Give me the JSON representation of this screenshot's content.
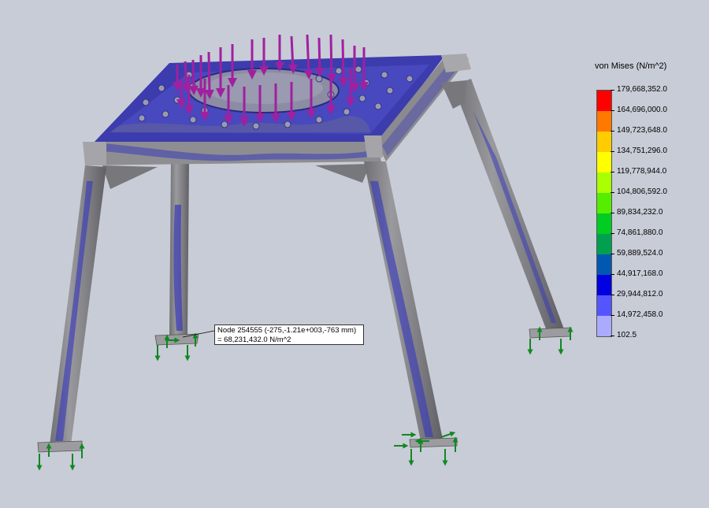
{
  "legend": {
    "title": "von Mises (N/m^2)",
    "levels": [
      {
        "value": "179,668,352.0",
        "color": "#ff0000"
      },
      {
        "value": "164,696,000.0",
        "color": "#ff7800"
      },
      {
        "value": "149,723,648.0",
        "color": "#ffcc00"
      },
      {
        "value": "134,751,296.0",
        "color": "#ffff00"
      },
      {
        "value": "119,778,944.0",
        "color": "#aaff00"
      },
      {
        "value": "104,806,592.0",
        "color": "#55ee00"
      },
      {
        "value": "89,834,232.0",
        "color": "#00cc22"
      },
      {
        "value": "74,861,880.0",
        "color": "#00a050"
      },
      {
        "value": "59,889,524.0",
        "color": "#0058b0"
      },
      {
        "value": "44,917,168.0",
        "color": "#0000e0"
      },
      {
        "value": "29,944,812.0",
        "color": "#5555ff"
      },
      {
        "value": "14,972,458.0",
        "color": "#aaaaff"
      },
      {
        "value": "102.5",
        "color": "#ffffff"
      }
    ]
  },
  "probe": {
    "node_line": "Node 254555 (-275,-1.21e+003,-763 mm)",
    "value_line": "= 68,231,432.0 N/m^2"
  },
  "colors": {
    "background": "#c8ccd6",
    "steel": "#8a8a8e",
    "stress_low": "#3a3ab8",
    "load_arrow": "#a020a0",
    "fixture_arrow": "#118822"
  }
}
